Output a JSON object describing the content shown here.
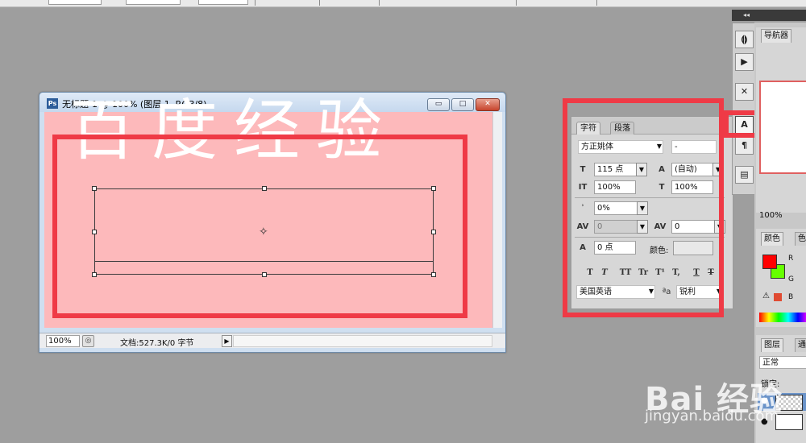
{
  "doc": {
    "title": "无标题-1 @ 100% (图层 1, RGB/8)",
    "app_icon": "Ps",
    "window_buttons": {
      "minimize": "▭",
      "restore": "□",
      "close": "✕"
    },
    "canvas_text": "百度经验",
    "zoom": "100%",
    "info": "文档:527.3K/0 字节",
    "status_icon": "◎",
    "arrow": "▶"
  },
  "char_panel": {
    "tabs": [
      "字符",
      "段落"
    ],
    "font_family": "方正姚体",
    "font_style": "-",
    "font_size": "115 点",
    "leading": "(自动)",
    "vertical_scale": "100%",
    "horizontal_scale": "100%",
    "tsume": "0%",
    "kerning": "0",
    "tracking": "0",
    "baseline_shift": "0 点",
    "color_label": "颜色:",
    "style_buttons": [
      "T",
      "T",
      "TT",
      "Tr",
      "T¹",
      "T,",
      "T",
      "T"
    ],
    "language": "美国英语",
    "antialias_icon": "ªa",
    "antialias": "锐利",
    "dropdown_arrow": "▼",
    "icons": {
      "size": "T",
      "leading": "A",
      "vscale": "IT",
      "hscale": "T",
      "tsume": "ʾ",
      "kerning": "AV",
      "tracking": "AV",
      "baseline": "A"
    }
  },
  "tool_strip": {
    "collapse": "◂◂",
    "tools": [
      "⟬⟭",
      "▶",
      "✕",
      "A",
      "¶",
      "▤"
    ]
  },
  "right_panels": {
    "navigator_tab": "导航器",
    "zoom": "100%",
    "color_tab": "颜色",
    "color_tab2": "色",
    "layers_tab": "图层",
    "layers_tab2": "通",
    "blend_mode": "正常",
    "lock_label": "锁定:",
    "rgb": {
      "r": "R",
      "g": "G",
      "b": "B"
    },
    "colors": {
      "fg": "#ff0000",
      "bg": "#66ff00"
    }
  },
  "watermark": {
    "brand": "Bai 经验",
    "url": "jingyan.baidu.com"
  },
  "colors": {
    "canvas": "#fdb9bb",
    "annotation": "#ef3a46"
  }
}
